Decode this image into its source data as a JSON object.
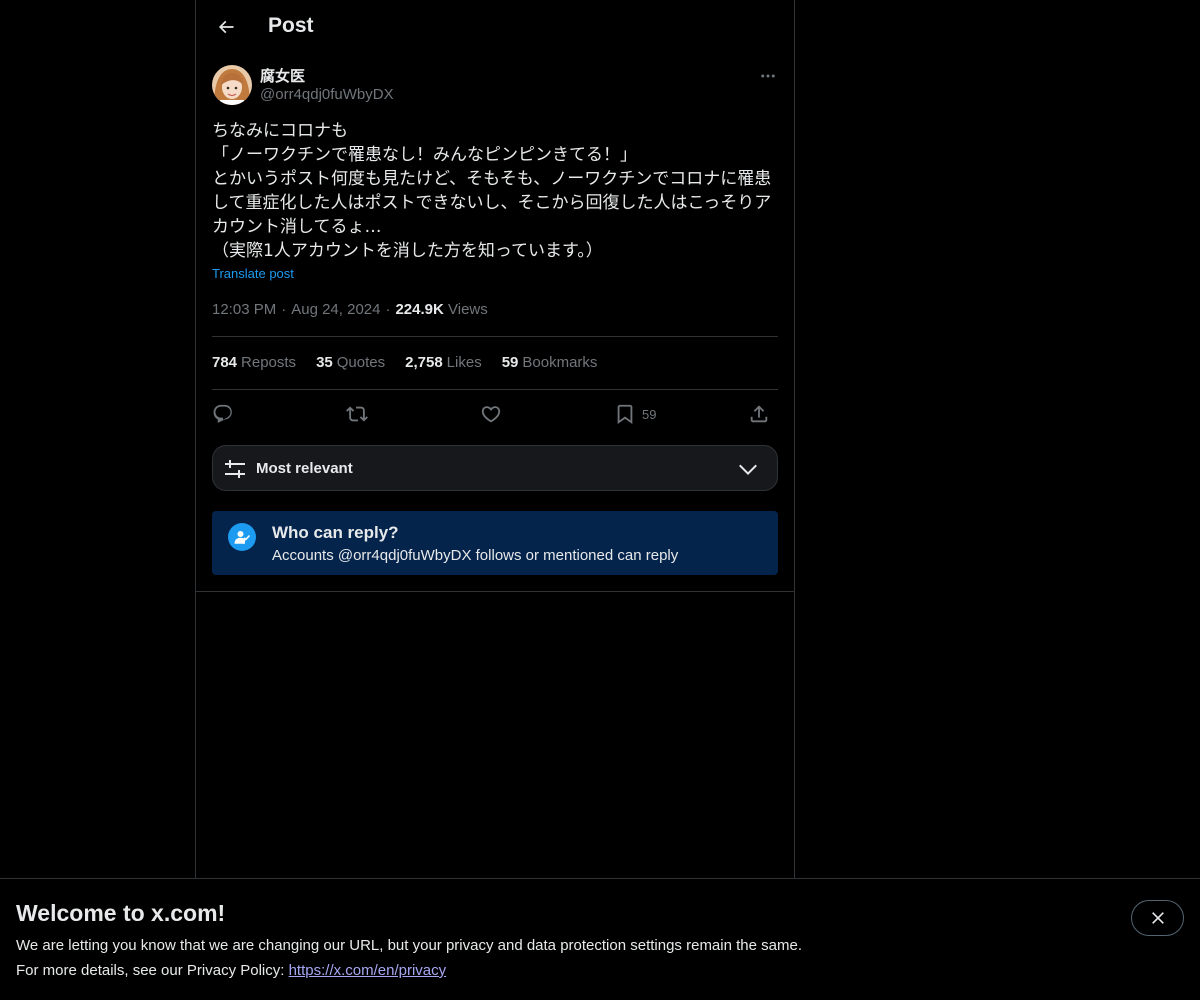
{
  "header": {
    "title": "Post",
    "back_icon": "arrow-left-icon"
  },
  "post": {
    "author": {
      "display_name": "腐女医",
      "handle": "@orr4qdj0fuWbyDX"
    },
    "text": "ちなみにコロナも\n「ノーワクチンで罹患なし！みんなピンピンきてる！」\nとかいうポスト何度も見たけど、そもそも、ノーワクチンでコロナに罹患して重症化した人はポストできないし、そこから回復した人はこっそりアカウント消してるょ…\n（実際1人アカウントを消した方を知っています。）",
    "translate_label": "Translate post",
    "time": "12:03 PM",
    "date": "Aug 24, 2024",
    "views_count": "224.9K",
    "views_label": "Views",
    "separator": "·"
  },
  "stats": [
    {
      "count": "784",
      "label": "Reposts"
    },
    {
      "count": "35",
      "label": "Quotes"
    },
    {
      "count": "2,758",
      "label": "Likes"
    },
    {
      "count": "59",
      "label": "Bookmarks"
    }
  ],
  "actions": {
    "reply_icon": "reply-icon",
    "repost_icon": "repost-icon",
    "like_icon": "heart-icon",
    "bookmark_icon": "bookmark-icon",
    "bookmark_count": "59",
    "share_icon": "share-icon"
  },
  "sort": {
    "label": "Most relevant"
  },
  "who_can_reply": {
    "title": "Who can reply?",
    "subtitle": "Accounts @orr4qdj0fuWbyDX follows or mentioned can reply"
  },
  "banner": {
    "title": "Welcome to x.com!",
    "line1": "We are letting you know that we are changing our URL, but your privacy and data protection settings remain the same.",
    "line2_prefix": "For more details, see our Privacy Policy: ",
    "link": "https://x.com/en/privacy"
  },
  "colors": {
    "background": "#000000",
    "text": "#e7e9ea",
    "muted": "#71767b",
    "accent": "#1d9bf0",
    "info_box": "#04244c",
    "border": "#2f3336"
  }
}
